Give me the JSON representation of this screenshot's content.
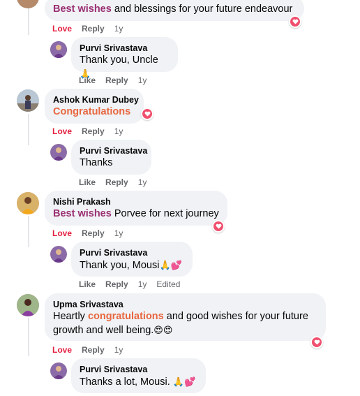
{
  "comments": [
    {
      "highlight": "Best wishes",
      "rest": " and blessings for your future endeavour",
      "actions": {
        "love": "Love",
        "reply": "Reply",
        "time": "1y"
      },
      "reply": {
        "name": "Purvi Srivastava",
        "text": "Thank you, Uncle",
        "emoji": "🙏",
        "actions": {
          "like": "Like",
          "reply": "Reply",
          "time": "1y"
        }
      }
    },
    {
      "name": "Ashok Kumar Dubey",
      "highlight": "Congratulations",
      "rest": "",
      "actions": {
        "love": "Love",
        "reply": "Reply",
        "time": "1y"
      },
      "reply": {
        "name": "Purvi Srivastava",
        "text": "Thanks",
        "emoji": "",
        "actions": {
          "like": "Like",
          "reply": "Reply",
          "time": "1y"
        }
      }
    },
    {
      "name": "Nishi Prakash",
      "highlight": "Best wishes",
      "rest": " Porvee for next journey",
      "actions": {
        "love": "Love",
        "reply": "Reply",
        "time": "1y"
      },
      "reply": {
        "name": "Purvi Srivastava",
        "text": "Thank you, Mousi",
        "emoji": "🙏💕",
        "actions": {
          "like": "Like",
          "reply": "Reply",
          "time": "1y",
          "edited": "Edited"
        }
      }
    },
    {
      "name": "Upma Srivastava",
      "pre": "Heartly ",
      "highlight": "congratulations",
      "rest": " and good wishes for your future",
      "line2": "growth and well being.",
      "emoji": "😍😍",
      "actions": {
        "love": "Love",
        "reply": "Reply",
        "time": "1y"
      },
      "reply": {
        "name": "Purvi Srivastava",
        "text": "Thanks a lot, Mousi. ",
        "emoji": "🙏💕"
      }
    }
  ],
  "colors": {
    "highlight_purple": "#9b2f73",
    "highlight_orange": "#e8663f",
    "love": "#e41e3f",
    "bubble": "#f0f2f5",
    "heart": "#f0506e"
  }
}
